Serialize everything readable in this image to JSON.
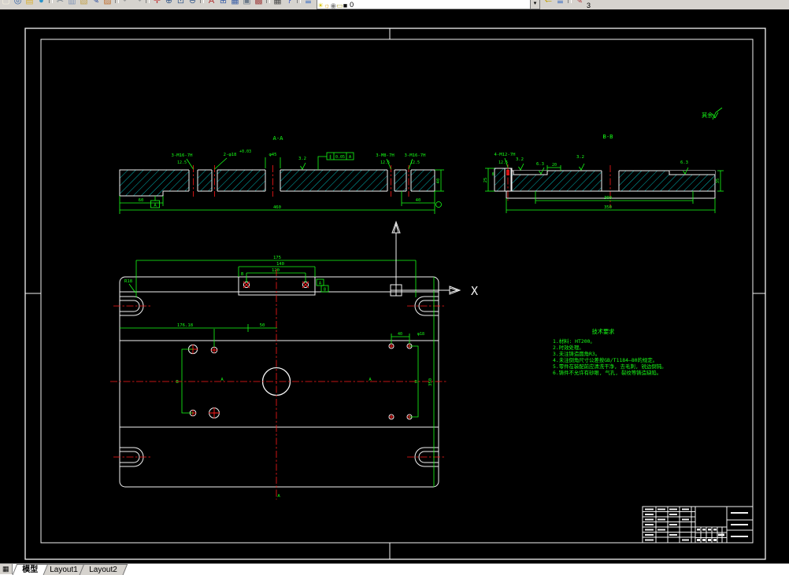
{
  "colors": {
    "background": "#000000",
    "line": "#f2f2f2",
    "dimension": "#17ff17",
    "centerline": "#ff1a1a",
    "hatch": "#00c8c8",
    "toolbar_bg": "#d6d3ce"
  },
  "toolbar": {
    "icons": [
      {
        "n": "new-doc-icon",
        "g": "▢",
        "c": "#f5f2e0"
      },
      {
        "n": "binoculars-icon",
        "g": "◎",
        "c": "#2f5fa5"
      },
      {
        "n": "sheets-icon",
        "g": "▤",
        "c": "#d9b33a"
      },
      {
        "n": "globe-icon",
        "g": "●",
        "c": "#2b93c9"
      },
      {
        "d": true
      },
      {
        "n": "cut-icon",
        "g": "✂",
        "c": "#5d6d7e"
      },
      {
        "n": "copy-icon",
        "g": "▥",
        "c": "#7f93b5"
      },
      {
        "n": "paste-icon",
        "g": "▧",
        "c": "#c3a34f"
      },
      {
        "n": "pencil-icon",
        "g": "✎",
        "c": "#2c4da0"
      },
      {
        "n": "brush-icon",
        "g": "▨",
        "c": "#c06f2e"
      },
      {
        "d": true
      },
      {
        "n": "undo-icon",
        "g": "↶",
        "c": "#9d9d9d"
      },
      {
        "n": "redo-icon",
        "g": "↷",
        "c": "#9d9d9d"
      },
      {
        "d": true
      },
      {
        "n": "pan-hand-icon",
        "g": "✛",
        "c": "#c23b3b"
      },
      {
        "n": "zoom-in-icon",
        "g": "⊕",
        "c": "#40618f"
      },
      {
        "n": "zoom-window-icon",
        "g": "⊡",
        "c": "#40618f"
      },
      {
        "n": "zoom-out-icon",
        "g": "⊖",
        "c": "#40618f"
      },
      {
        "d": true
      },
      {
        "n": "find-text-icon",
        "g": "A",
        "c": "#b03232"
      },
      {
        "n": "table-icon",
        "g": "⊞",
        "c": "#3f62a8"
      },
      {
        "n": "cells-icon",
        "g": "▦",
        "c": "#3f62a8"
      },
      {
        "n": "image-icon",
        "g": "▣",
        "c": "#6d7b8a"
      },
      {
        "n": "ole-icon",
        "g": "▩",
        "c": "#a04343"
      },
      {
        "d": true
      },
      {
        "n": "calculator-icon",
        "g": "▦",
        "c": "#4d4d4d"
      },
      {
        "n": "help-icon",
        "g": "?",
        "c": "#1d3fc0"
      },
      {
        "d": true
      },
      {
        "n": "layers-icon",
        "g": "≣",
        "c": "#3e6fc2"
      }
    ],
    "layer_states": [
      {
        "n": "layer-on-bulb-icon",
        "g": "☀",
        "c": "#d8c400"
      },
      {
        "n": "layer-freeze-sun-icon",
        "g": "☼",
        "c": "#d89c00"
      },
      {
        "n": "layer-lock-icon",
        "g": "◉",
        "c": "#8a8a8a"
      },
      {
        "n": "layer-plot-icon",
        "g": "▭",
        "c": "#b1a43e"
      },
      {
        "n": "layer-color-swatch",
        "g": "■",
        "c": "#111111"
      }
    ],
    "layer_value": "0",
    "dropdown_glyph": "▾",
    "right_icons": [
      {
        "n": "layer-previous-icon",
        "g": "⇐",
        "c": "#c2a100"
      },
      {
        "n": "layer-states-icon",
        "g": "≣",
        "c": "#3e6fc2"
      },
      {
        "d": true
      },
      {
        "n": "properties-pencil-icon",
        "g": "✎",
        "c": "#b04040"
      }
    ],
    "right_text": "3"
  },
  "tabs": {
    "nav_icon": "▦",
    "items": [
      "模型",
      "Layout1",
      "Layout2"
    ],
    "active": "模型"
  },
  "drawing": {
    "aa": {
      "title": "A-A",
      "c1": "3-M16-7H",
      "c1r": "12.5",
      "c2": "2-φ18",
      "c2s": "+0.03",
      "c3": "φ45",
      "c4": "3.2",
      "f1": "∥",
      "f2": "0.05",
      "f3": "A",
      "c5": "3-M8-7H",
      "c5r": "12.5",
      "c6": "3-M16-7H",
      "c6r": "12.5",
      "datum": "A",
      "d60": "60",
      "dov": "460",
      "d40": "40",
      "d40v": "40"
    },
    "bb": {
      "title": "B-B",
      "c1": "4-M12-7H",
      "c1r": "12.5",
      "r1": "3.2",
      "r2": "6.3",
      "d20": "20",
      "r3": "3.2",
      "r4": "6.3",
      "d25": "25",
      "d8": "8",
      "din": "300",
      "dout": "350",
      "d35": "35"
    },
    "plan": {
      "d175": "175",
      "d140": "140",
      "d120": "120",
      "r18": "R18",
      "d176": "176.18",
      "d50": "50",
      "d40": "40",
      "dphi": "φ18",
      "d350": "350",
      "a": "A",
      "b": "B",
      "boxa": "A",
      "boxb": "B"
    },
    "notes": {
      "title": "技术要求",
      "l1": "1.材料: HT200。",
      "l2": "2.时效处理。",
      "l3": "3.未注铸造圆角R3。",
      "l4": "4.未注倒角尺寸公差按GB/T1184—80的规定。",
      "l5": "5.零件在装配前应清洗干净, 去毛刺, 锐边倒钝。",
      "l6": "6.铸件不允许有砂眼, 气孔, 裂纹等铸造缺陷。"
    },
    "finish_label": "其余",
    "ucs_x": "X"
  }
}
